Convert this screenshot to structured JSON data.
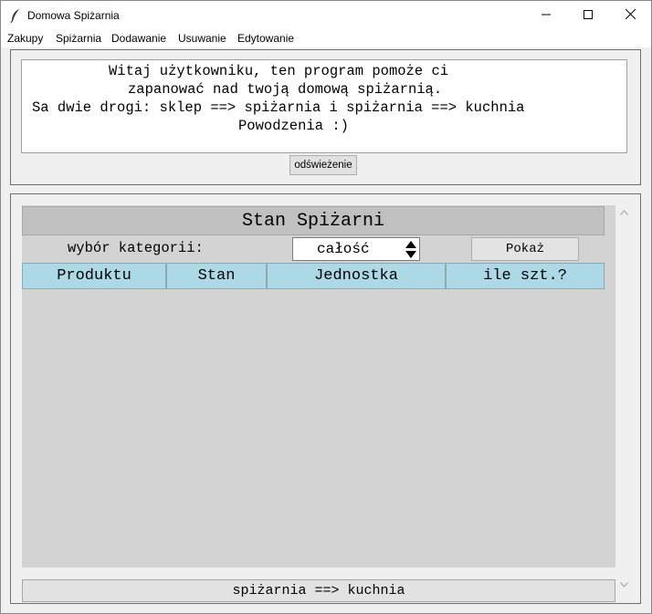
{
  "window": {
    "title": "Domowa Spiżarnia",
    "icon": "feather-icon",
    "controls": [
      "minimize-icon",
      "maximize-icon",
      "close-icon"
    ]
  },
  "menu": {
    "items": [
      "Zakupy",
      "Spiżarnia",
      "Dodawanie",
      "Usuwanie",
      "Edytowanie"
    ]
  },
  "welcome": {
    "lines": [
      "Witaj użytkowniku, ten program pomoże ci",
      "zapanować nad twoją domową spiżarnią.",
      "Sa dwie drogi: sklep ==> spiżarnia i spiżarnia ==> kuchnia",
      "Powodzenia :)"
    ],
    "refresh_label": "odświeżenie"
  },
  "pantry": {
    "title": "Stan Spiżarni",
    "category_label": "wybór kategorii:",
    "category_value": "całość",
    "show_label": "Pokaż",
    "columns": [
      "Produktu",
      "Stan",
      "Jednostka",
      "ile szt.?"
    ],
    "bottom_button": "spiżarnia ==> kuchnia"
  },
  "colors": {
    "header_bg": "#c0c0c0",
    "column_bg": "#add8e6",
    "panel_bg": "#d3d3d3"
  }
}
